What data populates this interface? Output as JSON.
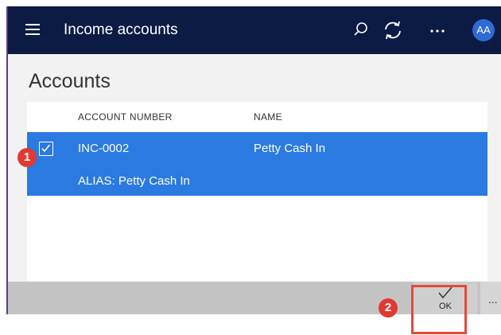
{
  "app": {
    "title": "Income accounts",
    "avatar_initials": "AA"
  },
  "icons": {
    "menu": "hamburger-icon",
    "search": "search-icon",
    "refresh": "refresh-icon",
    "more": "ellipsis-icon",
    "check": "checkmark-icon"
  },
  "colors": {
    "topbar": "#0b1b44",
    "selection": "#2a7ae2",
    "avatar": "#2e6ad8",
    "callout": "#e03a33"
  },
  "page": {
    "title": "Accounts"
  },
  "grid": {
    "columns": [
      "ACCOUNT NUMBER",
      "NAME"
    ],
    "rows": [
      {
        "selected": true,
        "account_number": "INC-0002",
        "name": "Petty Cash In",
        "alias": "ALIAS: Petty Cash In"
      }
    ]
  },
  "toolbar": {
    "ok_label": "OK",
    "more_label": "..."
  },
  "callouts": [
    "1",
    "2"
  ]
}
